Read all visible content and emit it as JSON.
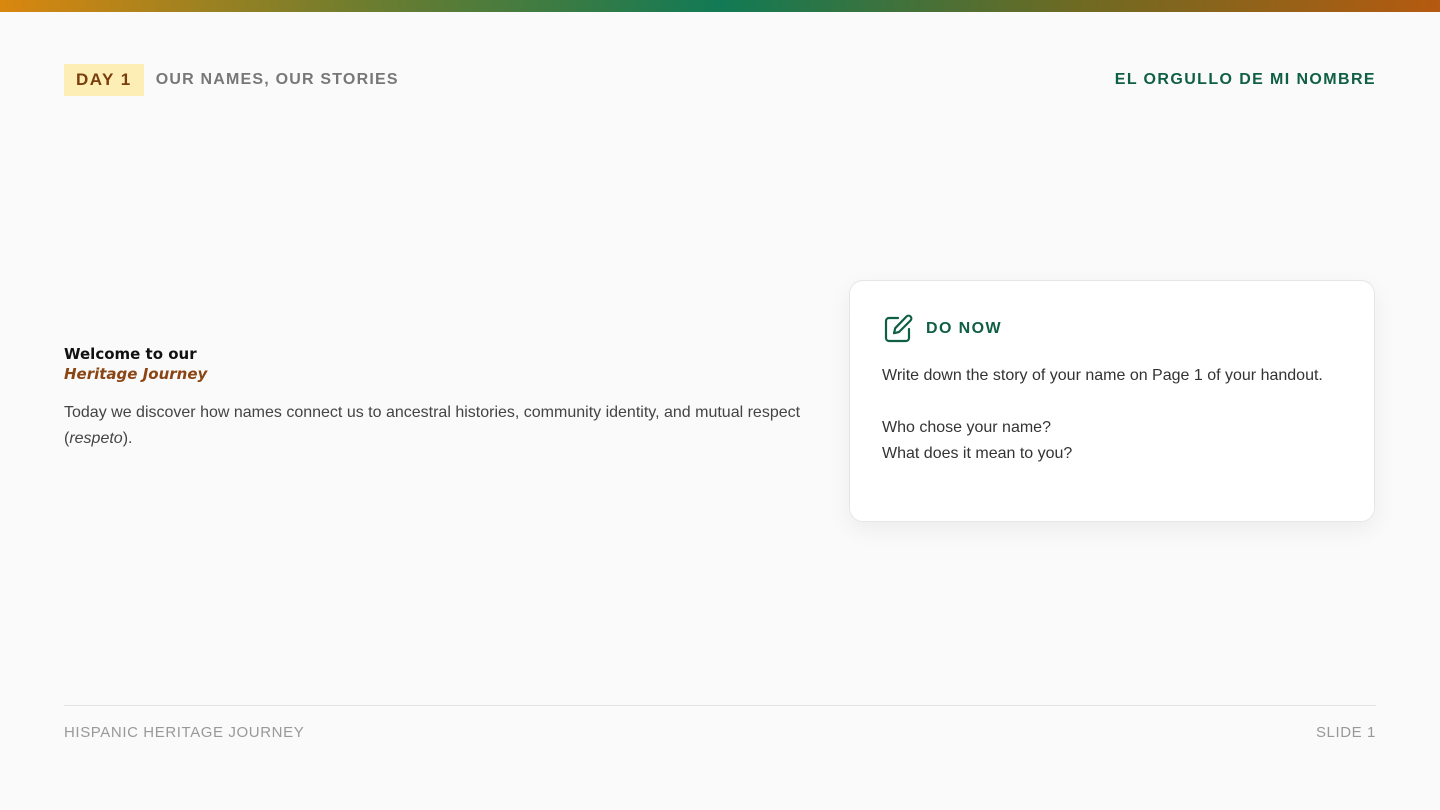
{
  "header": {
    "day_label": "DAY 1",
    "lesson_title": "OUR NAMES, OUR STORIES",
    "theme_title": "EL ORGULLO DE MI NOMBRE"
  },
  "intro": {
    "welcome": "Welcome to our",
    "welcome_accent": "Heritage Journey",
    "desc_before": "Today we discover how names connect us to ancestral histories, community identity, and mutual respect (",
    "desc_italic": "respeto",
    "desc_after": ")."
  },
  "do_now": {
    "icon": "edit-icon",
    "title": "DO NOW",
    "instruction": "Write down the story of your name on Page 1 of your handout.",
    "question_1": "Who chose your name?",
    "question_2": "What does it mean to you?"
  },
  "footer": {
    "left": "HISPANIC HERITAGE JOURNEY",
    "right": "SLIDE 1"
  },
  "colors": {
    "green": "#0f5f44",
    "brown": "#8b4513",
    "badge_bg": "#fdeeb6"
  }
}
